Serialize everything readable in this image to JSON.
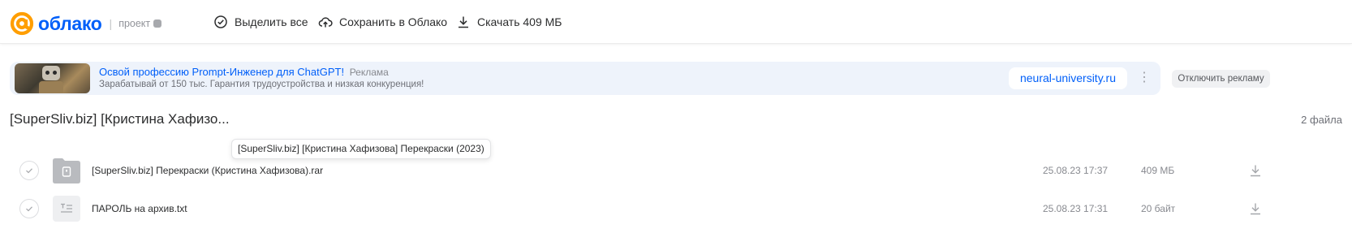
{
  "header": {
    "logo_text": "облако",
    "separator": "|",
    "project_label": "проект",
    "vk_badge": "vk",
    "actions": {
      "select_all": "Выделить все",
      "save_to_cloud": "Сохранить в Облако",
      "download": "Скачать 409 МБ"
    }
  },
  "ad": {
    "title": "Освой профессию Prompt-Инженер для ChatGPT!",
    "label": "Реклама",
    "description": "Зарабатывай от 150 тыс. Гарантия трудоустройства и низкая конкуренция!",
    "url": "neural-university.ru",
    "more_icon": "⋮",
    "disable_label": "Отключить рекламу"
  },
  "folder": {
    "title": "[SuperSliv.biz] [Кристина Хафизо...",
    "count": "2 файла",
    "tooltip": "[SuperSliv.biz] [Кристина Хафизова] Перекраски (2023)"
  },
  "files": [
    {
      "name": "[SuperSliv.biz] Перекраски (Кристина Хафизова).rar",
      "date": "25.08.23 17:37",
      "size": "409 МБ",
      "icon": "archive-icon"
    },
    {
      "name": "ПАРОЛЬ на архив.txt",
      "date": "25.08.23 17:31",
      "size": "20 байт",
      "icon": "text-file-icon"
    }
  ],
  "colors": {
    "brand_blue": "#005ff9",
    "logo_orange": "#ff9e00",
    "ad_background": "#eef3fb"
  }
}
